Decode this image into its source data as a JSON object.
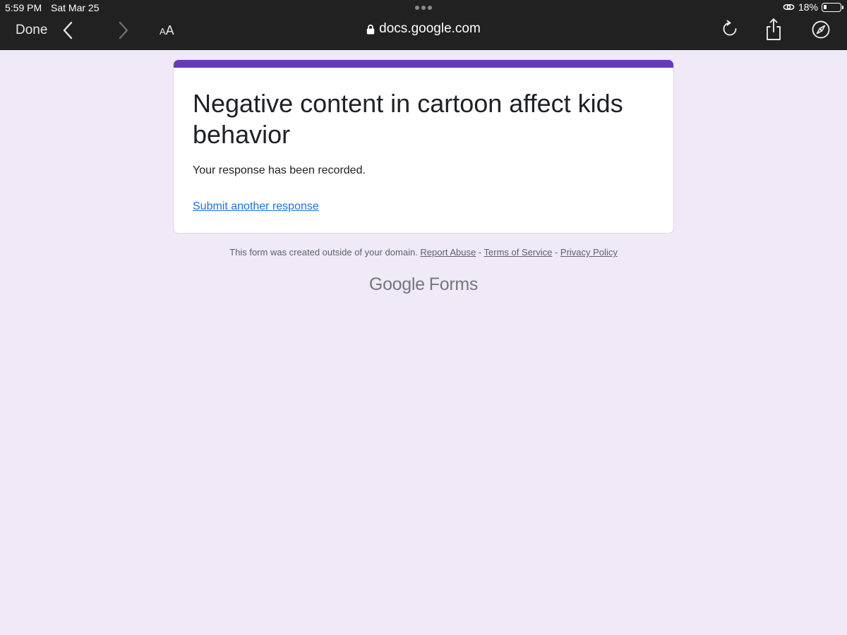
{
  "status_bar": {
    "time": "5:59 PM",
    "date": "Sat Mar 25",
    "battery_percent": "18%",
    "battery_level": 0.18
  },
  "browser": {
    "done_label": "Done",
    "text_size_small": "A",
    "text_size_large": "A",
    "url": "docs.google.com",
    "icons": {
      "back": "chevron-left-icon",
      "forward": "chevron-right-icon",
      "lock": "lock-icon",
      "reload": "reload-icon",
      "share": "share-icon",
      "compass": "compass-icon"
    }
  },
  "form": {
    "accent_color": "#673ab7",
    "title": "Negative content in cartoon affect kids behavior",
    "message": "Your response has been recorded.",
    "another_response_link": "Submit another response"
  },
  "footer": {
    "notice": "This form was created outside of your domain.",
    "report_abuse": "Report Abuse",
    "separator": " - ",
    "terms": "Terms of Service",
    "privacy": "Privacy Policy",
    "logo_google": "Google",
    "logo_forms": "Forms"
  }
}
